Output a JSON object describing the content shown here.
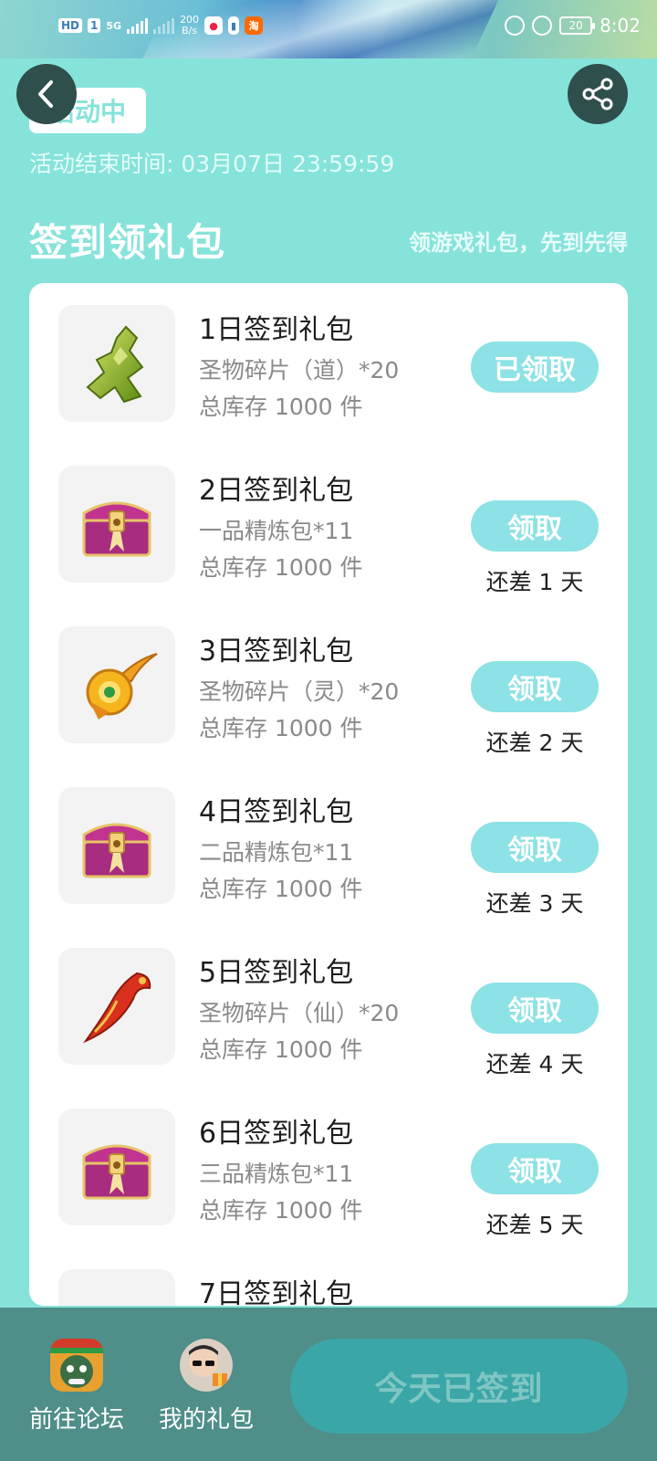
{
  "statusbar": {
    "hd": "HD",
    "sim": "1",
    "net": "5G",
    "speed_value": "200",
    "speed_unit": "B/s",
    "taobao": "淘",
    "battery": "20",
    "time": "8:02"
  },
  "header": {
    "status_pill": "活动中",
    "end_time": "活动结束时间: 03月07日 23:59:59",
    "section_title": "签到领礼包",
    "section_sub": "领游戏礼包，先到先得"
  },
  "gifts": [
    {
      "title": "1日签到礼包",
      "desc": "圣物碎片（道）*20",
      "stock": "总库存 1000 件",
      "button": "已领取",
      "remain": "",
      "icon": "jade-shard-icon"
    },
    {
      "title": "2日签到礼包",
      "desc": "一品精炼包*11",
      "stock": "总库存 1000 件",
      "button": "领取",
      "remain": "还差 1 天",
      "icon": "treasure-chest-icon"
    },
    {
      "title": "3日签到礼包",
      "desc": "圣物碎片（灵）*20",
      "stock": "总库存 1000 件",
      "button": "领取",
      "remain": "还差 2 天",
      "icon": "gold-shard-icon"
    },
    {
      "title": "4日签到礼包",
      "desc": "二品精炼包*11",
      "stock": "总库存 1000 件",
      "button": "领取",
      "remain": "还差 3 天",
      "icon": "treasure-chest-icon"
    },
    {
      "title": "5日签到礼包",
      "desc": "圣物碎片（仙）*20",
      "stock": "总库存 1000 件",
      "button": "领取",
      "remain": "还差 4 天",
      "icon": "red-shard-icon"
    },
    {
      "title": "6日签到礼包",
      "desc": "三品精炼包*11",
      "stock": "总库存 1000 件",
      "button": "领取",
      "remain": "还差 5 天",
      "icon": "treasure-chest-icon"
    },
    {
      "title": "7日签到礼包",
      "desc": "",
      "stock": "",
      "button": "",
      "remain": "",
      "icon": "gift-icon"
    }
  ],
  "bottombar": {
    "forum_label": "前往论坛",
    "mygift_label": "我的礼包",
    "checkin_label": "今天已签到"
  },
  "colors": {
    "background": "#86E3DA",
    "button": "#8CE2E4",
    "bottombar": "#4F8E89",
    "checkin_button": "#3BA6A7"
  }
}
